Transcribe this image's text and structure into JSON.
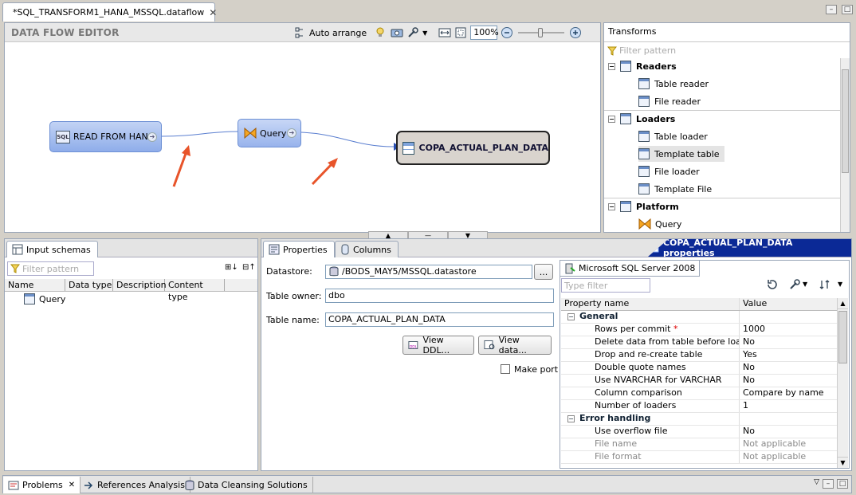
{
  "editor": {
    "tab_title": "*SQL_TRANSFORM1_HANA_MSSQL.dataflow",
    "header_title": "DATA FLOW EDITOR",
    "auto_arrange": "Auto arrange",
    "zoom": "100%"
  },
  "flow": {
    "source": "READ FROM HANA",
    "sql_badge": "SQL",
    "query": "Query",
    "target": "COPA_ACTUAL_PLAN_DATA"
  },
  "transforms": {
    "title": "Transforms",
    "filter_placeholder": "Filter pattern",
    "groups": [
      {
        "label": "Readers",
        "items": [
          "Table reader",
          "File reader"
        ]
      },
      {
        "label": "Loaders",
        "items": [
          "Table loader",
          "Template table",
          "File loader",
          "Template File"
        ]
      },
      {
        "label": "Platform",
        "items": [
          "Query"
        ]
      }
    ]
  },
  "input_schemas": {
    "tab_label": "Input schemas",
    "filter_placeholder": "Filter pattern",
    "columns": [
      "Name",
      "Data type",
      "Description",
      "Content type"
    ],
    "rows": [
      "Query"
    ]
  },
  "properties": {
    "tabs": [
      "Properties",
      "Columns"
    ],
    "title": "COPA_ACTUAL_PLAN_DATA properties",
    "datastore_label": "Datastore:",
    "datastore_value": "/BODS_MAY5/MSSQL.datastore",
    "owner_label": "Table owner:",
    "owner_value": "dbo",
    "name_label": "Table name:",
    "name_value": "COPA_ACTUAL_PLAN_DATA",
    "view_ddl": "View DDL...",
    "view_data": "View data...",
    "make_port": "Make port",
    "browse": "..."
  },
  "mssql": {
    "tab_label": "Microsoft SQL Server 2008",
    "filter_placeholder": "Type filter",
    "col_name": "Property name",
    "col_value": "Value",
    "rows": [
      {
        "type": "cat",
        "name": "General",
        "value": ""
      },
      {
        "type": "row",
        "name": "Rows per commit",
        "value": "1000",
        "required": "*"
      },
      {
        "type": "row",
        "name": "Delete data from table before loading",
        "value": "No"
      },
      {
        "type": "row",
        "name": "Drop and re-create table",
        "value": "Yes"
      },
      {
        "type": "row",
        "name": "Double quote names",
        "value": "No"
      },
      {
        "type": "row",
        "name": "Use NVARCHAR for VARCHAR",
        "value": "No"
      },
      {
        "type": "row",
        "name": "Column comparison",
        "value": "Compare by name"
      },
      {
        "type": "row",
        "name": "Number of loaders",
        "value": "1"
      },
      {
        "type": "cat",
        "name": "Error handling",
        "value": ""
      },
      {
        "type": "row",
        "name": "Use overflow file",
        "value": "No"
      },
      {
        "type": "dis",
        "name": "File name",
        "value": "Not applicable"
      },
      {
        "type": "dis",
        "name": "File format",
        "value": "Not applicable"
      }
    ]
  },
  "bottom": {
    "tabs": [
      "Problems",
      "References Analysis",
      "Data Cleansing Solutions"
    ]
  },
  "colors": {
    "accent": "#0b2996",
    "arrow": "#e8542a",
    "node": "#98b3ec"
  }
}
